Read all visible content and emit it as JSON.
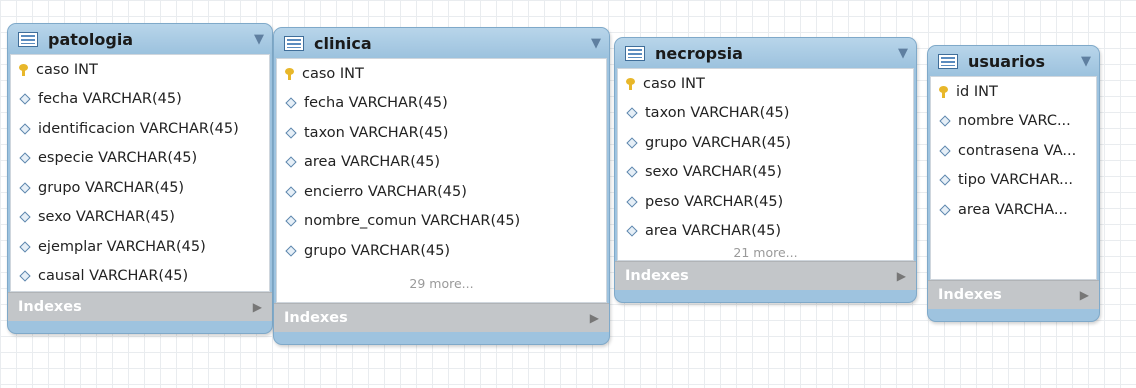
{
  "tables": [
    {
      "name": "patologia",
      "columns": [
        {
          "label": "caso INT",
          "key": true
        },
        {
          "label": "fecha VARCHAR(45)",
          "key": false
        },
        {
          "label": "identificacion VARCHAR(45)",
          "key": false
        },
        {
          "label": "especie VARCHAR(45)",
          "key": false
        },
        {
          "label": "grupo VARCHAR(45)",
          "key": false
        },
        {
          "label": "sexo VARCHAR(45)",
          "key": false
        },
        {
          "label": "ejemplar VARCHAR(45)",
          "key": false
        },
        {
          "label": "causal VARCHAR(45)",
          "key": false
        }
      ],
      "more": "",
      "indexes_label": "Indexes"
    },
    {
      "name": "clinica",
      "columns": [
        {
          "label": "caso INT",
          "key": true
        },
        {
          "label": "fecha VARCHAR(45)",
          "key": false
        },
        {
          "label": "taxon VARCHAR(45)",
          "key": false
        },
        {
          "label": "area VARCHAR(45)",
          "key": false
        },
        {
          "label": "encierro VARCHAR(45)",
          "key": false
        },
        {
          "label": "nombre_comun VARCHAR(45)",
          "key": false
        },
        {
          "label": "grupo VARCHAR(45)",
          "key": false
        }
      ],
      "more": "29 more...",
      "indexes_label": "Indexes"
    },
    {
      "name": "necropsia",
      "columns": [
        {
          "label": "caso INT",
          "key": true
        },
        {
          "label": "taxon VARCHAR(45)",
          "key": false
        },
        {
          "label": "grupo VARCHAR(45)",
          "key": false
        },
        {
          "label": "sexo VARCHAR(45)",
          "key": false
        },
        {
          "label": "peso VARCHAR(45)",
          "key": false
        },
        {
          "label": "area VARCHAR(45)",
          "key": false
        }
      ],
      "more": "21 more...",
      "indexes_label": "Indexes"
    },
    {
      "name": "usuarios",
      "columns": [
        {
          "label": "id INT",
          "key": true
        },
        {
          "label": "nombre VARC...",
          "key": false
        },
        {
          "label": "contrasena VA...",
          "key": false
        },
        {
          "label": "tipo VARCHAR...",
          "key": false
        },
        {
          "label": "area VARCHA...",
          "key": false
        }
      ],
      "more": "",
      "indexes_label": "Indexes"
    }
  ],
  "icons": {
    "table": "table-icon",
    "menu": "dropdown-arrow-icon",
    "primary_key": "key-icon",
    "column": "diamond-icon",
    "expand": "play-arrow-icon"
  }
}
